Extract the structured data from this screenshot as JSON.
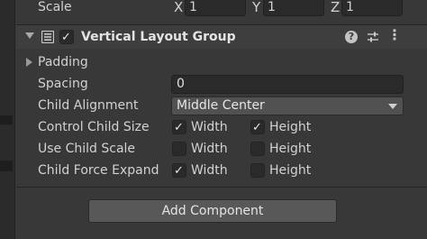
{
  "scale": {
    "label": "Scale",
    "x_axis": "X",
    "x_value": "1",
    "y_axis": "Y",
    "y_value": "1",
    "z_axis": "Z",
    "z_value": "1"
  },
  "component": {
    "title": "Vertical Layout Group",
    "enabled": true,
    "help_icon": "?",
    "presets_icon": "sliders-icon",
    "menu_icon": "⋮"
  },
  "fields": {
    "padding_label": "Padding",
    "spacing_label": "Spacing",
    "spacing_value": "0",
    "child_alignment_label": "Child Alignment",
    "child_alignment_value": "Middle Center",
    "control_child_size_label": "Control Child Size",
    "use_child_scale_label": "Use Child Scale",
    "child_force_expand_label": "Child Force Expand",
    "width_label": "Width",
    "height_label": "Height"
  },
  "toggles": {
    "control_child_size": {
      "width": true,
      "height": true
    },
    "use_child_scale": {
      "width": false,
      "height": false
    },
    "child_force_expand": {
      "width": true,
      "height": false
    }
  },
  "buttons": {
    "add_component": "Add Component"
  }
}
